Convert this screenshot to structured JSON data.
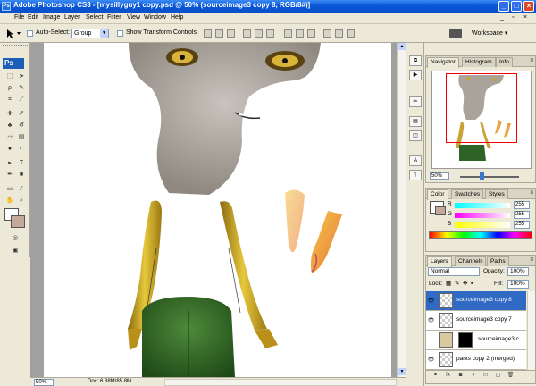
{
  "window": {
    "title": "Adobe Photoshop CS3 - [mysillyguy1 copy.psd @ 50% (sourceimage3 copy 8, RGB/8#)]",
    "app_icon": "Ps"
  },
  "menu": [
    "File",
    "Edit",
    "Image",
    "Layer",
    "Select",
    "Filter",
    "View",
    "Window",
    "Help"
  ],
  "options": {
    "auto_select_label": "Auto-Select:",
    "auto_select_value": "Group",
    "show_transform_label": "Show Transform Controls",
    "workspace_label": "Workspace ▾"
  },
  "toolbox": {
    "logo": "Ps"
  },
  "status": {
    "zoom": "50%",
    "doc_info": "Doc: 6.38M/85.8M"
  },
  "navigator": {
    "tabs": [
      "Navigator",
      "Histogram",
      "Info"
    ],
    "zoom": "50%"
  },
  "color_panel": {
    "tabs": [
      "Color",
      "Swatches",
      "Styles"
    ],
    "channels": [
      {
        "label": "R",
        "value": "255"
      },
      {
        "label": "G",
        "value": "255"
      },
      {
        "label": "B",
        "value": "255"
      }
    ]
  },
  "layers_panel": {
    "tabs": [
      "Layers",
      "Channels",
      "Paths"
    ],
    "blend_mode": "Normal",
    "opacity_label": "Opacity:",
    "opacity_value": "100%",
    "lock_label": "Lock:",
    "fill_label": "Fill:",
    "fill_value": "100%",
    "layers": [
      {
        "name": "sourceimage3 copy 8",
        "selected": true,
        "mask": false
      },
      {
        "name": "sourceimage3 copy 7",
        "selected": false,
        "mask": false
      },
      {
        "name": "sourceimage3 c...",
        "selected": false,
        "mask": true
      },
      {
        "name": "pants copy 2 (merged)",
        "selected": false,
        "mask": false
      }
    ]
  },
  "colors": {
    "titlebar": "#0a58d8",
    "selection": "#316ac5",
    "background_swatch": "#c4a89a",
    "navigator_view_box": "#ee0000"
  }
}
